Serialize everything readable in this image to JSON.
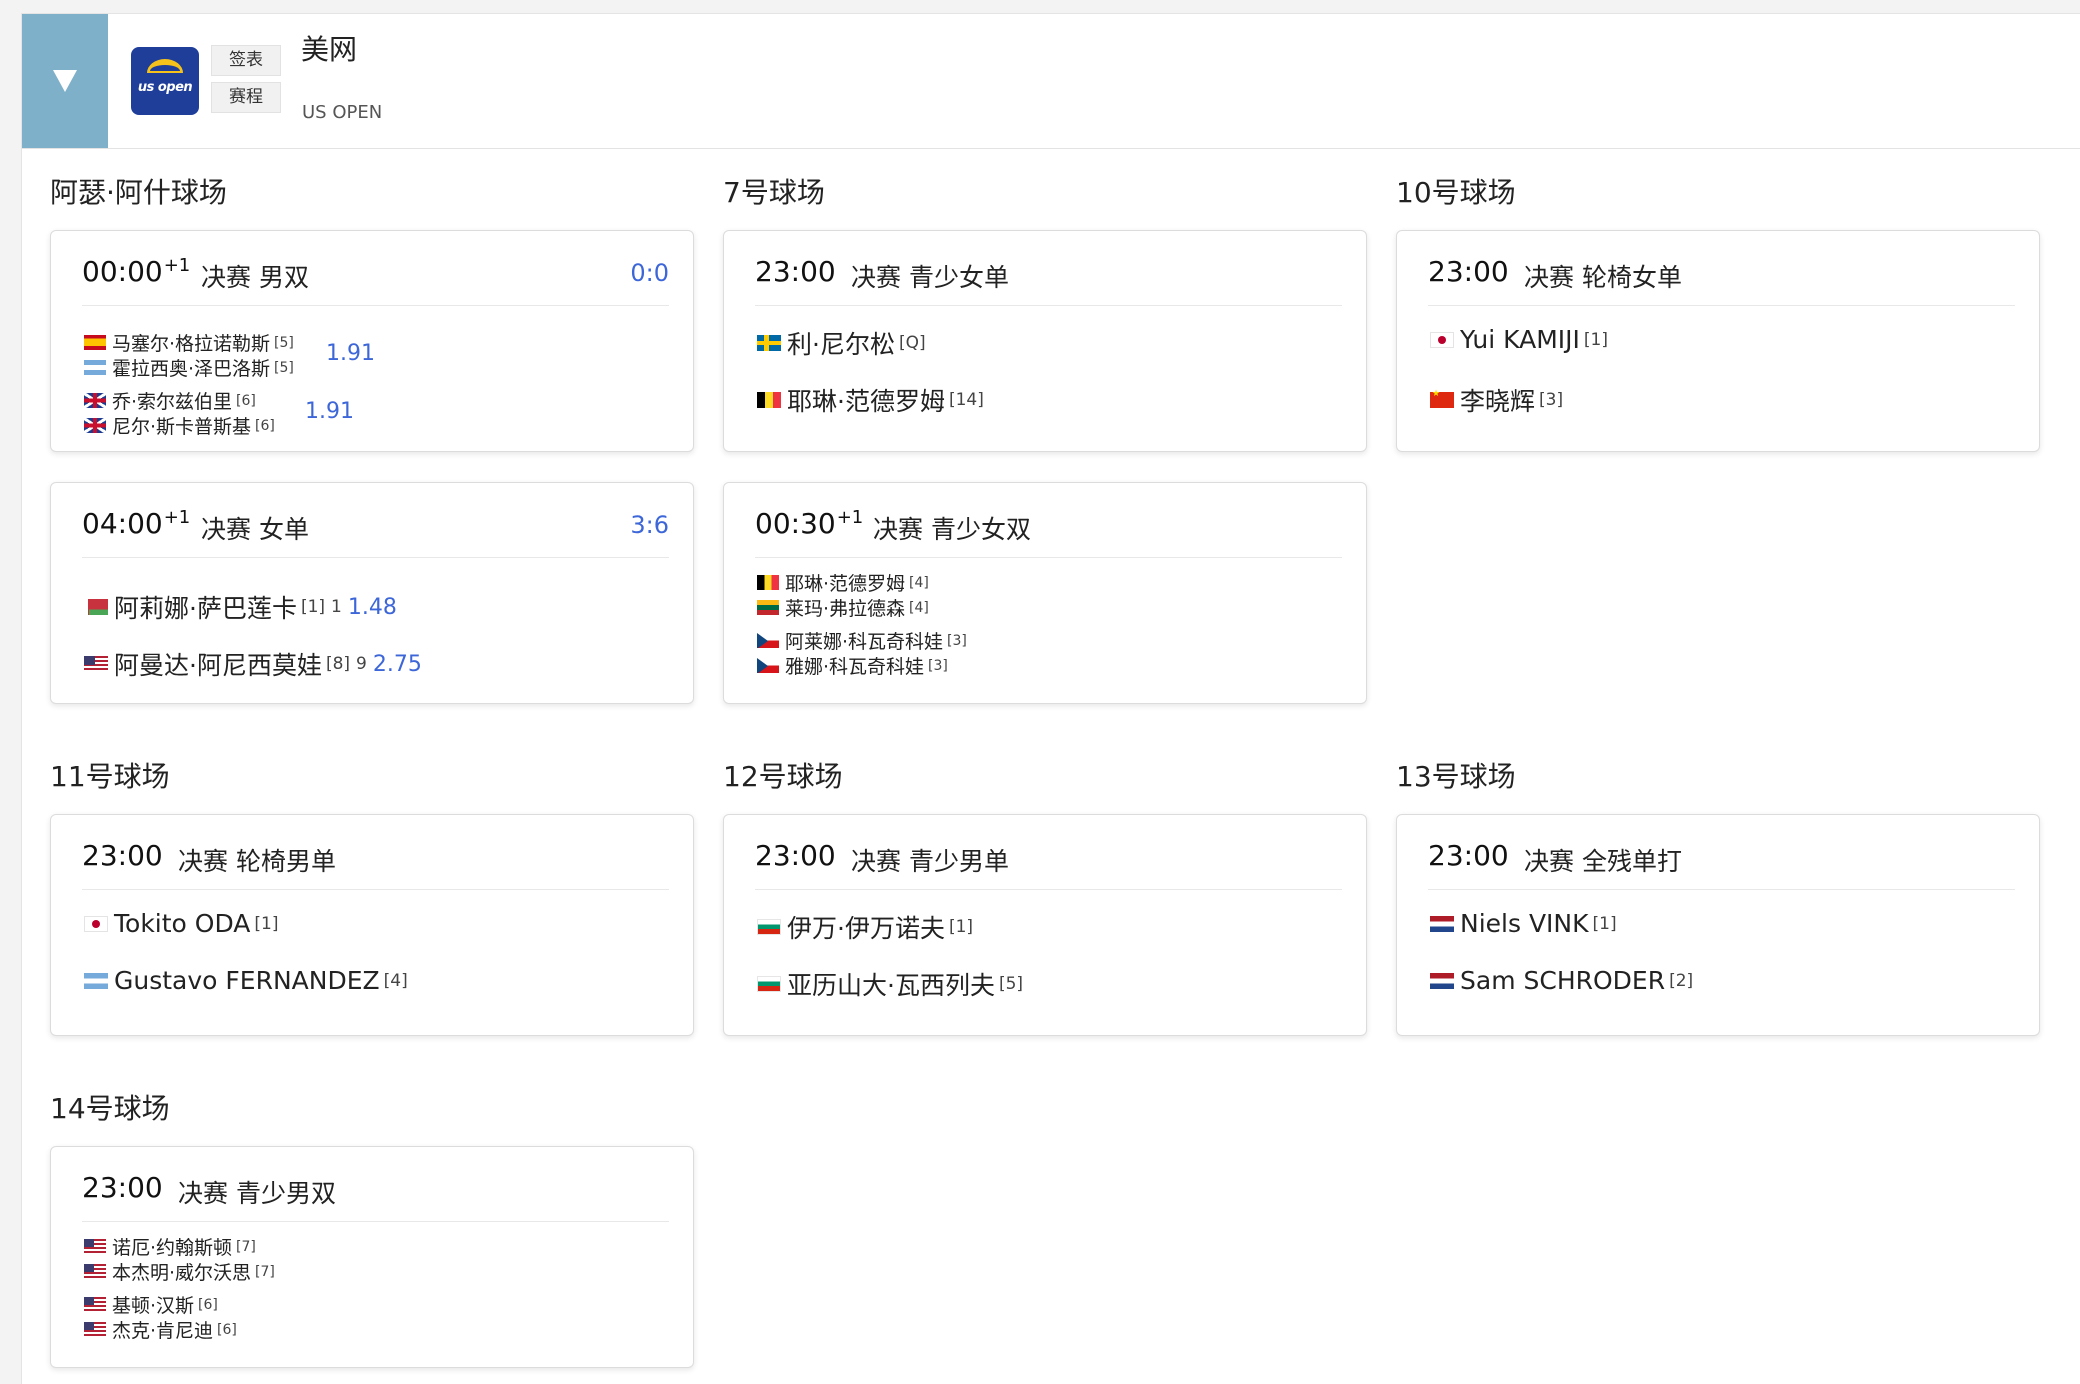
{
  "header": {
    "logo_text": "us open",
    "draw_button": "签表",
    "schedule_button": "赛程",
    "title": "美网",
    "subtitle": "US OPEN"
  },
  "courts": [
    {
      "name": "阿瑟·阿什球场",
      "matches": [
        {
          "time": "00:00",
          "day_offset": "+1",
          "round": "决赛",
          "event": "男双",
          "score": "0:0",
          "teams": [
            {
              "odds": "1.91",
              "players": [
                {
                  "flag": "ESP",
                  "name": "马塞尔·格拉诺勒斯",
                  "seed": "[5]"
                },
                {
                  "flag": "ARG",
                  "name": "霍拉西奥·泽巴洛斯",
                  "seed": "[5]"
                }
              ]
            },
            {
              "odds": "1.91",
              "players": [
                {
                  "flag": "GBR",
                  "name": "乔·索尔兹伯里",
                  "seed": "[6]"
                },
                {
                  "flag": "GBR",
                  "name": "尼尔·斯卡普斯基",
                  "seed": "[6]"
                }
              ]
            }
          ]
        },
        {
          "time": "04:00",
          "day_offset": "+1",
          "round": "决赛",
          "event": "女单",
          "score": "3:6",
          "players": [
            {
              "flag": "BLR",
              "name": "阿莉娜·萨巴莲卡",
              "seed": "[1]",
              "sets": "1",
              "odds": "1.48"
            },
            {
              "flag": "USA",
              "name": "阿曼达·阿尼西莫娃",
              "seed": "[8]",
              "sets": "9",
              "odds": "2.75"
            }
          ]
        }
      ]
    },
    {
      "name": "7号球场",
      "matches": [
        {
          "time": "23:00",
          "round": "决赛",
          "event": "青少女单",
          "players": [
            {
              "flag": "SWE",
              "name": "利·尼尔松",
              "seed": "[Q]"
            },
            {
              "flag": "BEL",
              "name": "耶琳·范德罗姆",
              "seed": "[14]"
            }
          ]
        },
        {
          "time": "00:30",
          "day_offset": "+1",
          "round": "决赛",
          "event": "青少女双",
          "teams": [
            {
              "players": [
                {
                  "flag": "BEL",
                  "name": "耶琳·范德罗姆",
                  "seed": "[4]"
                },
                {
                  "flag": "LTU",
                  "name": "莱玛·弗拉德森",
                  "seed": "[4]"
                }
              ]
            },
            {
              "players": [
                {
                  "flag": "CZE",
                  "name": "阿莱娜·科瓦奇科娃",
                  "seed": "[3]"
                },
                {
                  "flag": "CZE",
                  "name": "雅娜·科瓦奇科娃",
                  "seed": "[3]"
                }
              ]
            }
          ]
        }
      ]
    },
    {
      "name": "10号球场",
      "matches": [
        {
          "time": "23:00",
          "round": "决赛",
          "event": "轮椅女单",
          "players": [
            {
              "flag": "JPN",
              "name": "Yui KAMIJI",
              "seed": "[1]"
            },
            {
              "flag": "CHN",
              "name": "李晓辉",
              "seed": "[3]"
            }
          ]
        }
      ]
    },
    {
      "name": "11号球场",
      "matches": [
        {
          "time": "23:00",
          "round": "决赛",
          "event": "轮椅男单",
          "players": [
            {
              "flag": "JPN",
              "name": "Tokito ODA",
              "seed": "[1]"
            },
            {
              "flag": "ARG",
              "name": "Gustavo FERNANDEZ",
              "seed": "[4]"
            }
          ]
        }
      ]
    },
    {
      "name": "12号球场",
      "matches": [
        {
          "time": "23:00",
          "round": "决赛",
          "event": "青少男单",
          "players": [
            {
              "flag": "BGR",
              "name": "伊万·伊万诺夫",
              "seed": "[1]"
            },
            {
              "flag": "BGR",
              "name": "亚历山大·瓦西列夫",
              "seed": "[5]"
            }
          ]
        }
      ]
    },
    {
      "name": "13号球场",
      "matches": [
        {
          "time": "23:00",
          "round": "决赛",
          "event": "全残单打",
          "players": [
            {
              "flag": "NED",
              "name": "Niels VINK",
              "seed": "[1]"
            },
            {
              "flag": "NED",
              "name": "Sam SCHRODER",
              "seed": "[2]"
            }
          ]
        }
      ]
    },
    {
      "name": "14号球场",
      "matches": [
        {
          "time": "23:00",
          "round": "决赛",
          "event": "青少男双",
          "teams": [
            {
              "players": [
                {
                  "flag": "USA",
                  "name": "诺厄·约翰斯顿",
                  "seed": "[7]"
                },
                {
                  "flag": "USA",
                  "name": "本杰明·威尔沃思",
                  "seed": "[7]"
                }
              ]
            },
            {
              "players": [
                {
                  "flag": "USA",
                  "name": "基顿·汉斯",
                  "seed": "[6]"
                },
                {
                  "flag": "USA",
                  "name": "杰克·肯尼迪",
                  "seed": "[6]"
                }
              ]
            }
          ]
        }
      ]
    }
  ],
  "colors": {
    "accent_blue": "#3d67d8",
    "toggle_bg": "#7fb0c9",
    "logo_bg": "#1e3e9a"
  }
}
